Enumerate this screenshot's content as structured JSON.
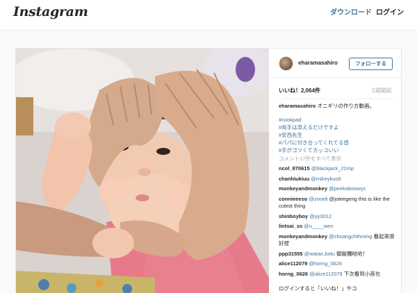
{
  "header": {
    "logo": "Instagram",
    "download_label": "ダウンロード",
    "login_label": "ログイン"
  },
  "post": {
    "username": "eharamasahiro",
    "follow_label": "フォローする",
    "likes": "いいね！2,064件",
    "time_ago": "2週間前",
    "caption_user": "eharamasahiro",
    "caption_text": " オニギリの作り方動画。",
    "tags": [
      "#cookpad",
      "#両手は添えるだけですよ",
      "#安西先生",
      "#パパに付き合ってくれてる感",
      "#手がゴツくてカッコいい"
    ],
    "view_all": "コメント17件をすべて表示",
    "comments": [
      {
        "user": "ncol_870615",
        "mention": "@blackjack_21mp",
        "text": ""
      },
      {
        "user": "chanhiukiuu",
        "mention": "@mikeykuo9",
        "text": ""
      },
      {
        "user": "monkeyandmonkey",
        "mention": "@peekaboowyc",
        "text": ""
      },
      {
        "user": "connieeeso",
        "mention": "@zooeli",
        "text": " @joieegeng this is like the cutest thing"
      },
      {
        "user": "shinboyboy",
        "mention": "@yy3012",
        "text": ""
      },
      {
        "user": "lintsai_ss",
        "mention": "@u____wen",
        "text": ""
      },
      {
        "user": "monkeyandmonkey",
        "mention": "@chuangchihming",
        "text": " 看起來很好捏"
      },
      {
        "user": "ppp31555",
        "mention": "@watan.botu",
        "text": " 御飯糰哈哈！"
      },
      {
        "user": "alice112079",
        "mention": "@horng_0626",
        "text": ""
      },
      {
        "user": "horng_0626",
        "mention": "@alice112079",
        "text": " 下次看到小孩也"
      }
    ],
    "footer": "ログインすると「いいね！」やコ"
  }
}
